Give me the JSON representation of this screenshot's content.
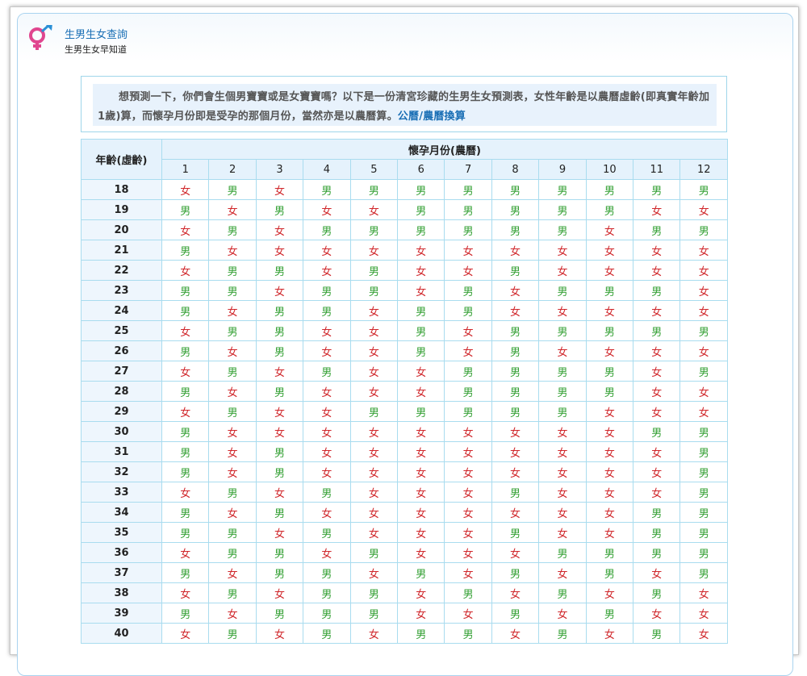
{
  "header": {
    "title": "生男生女查詢",
    "subtitle": "生男生女早知道",
    "logo_icon": "gender-symbol-icon"
  },
  "intro": {
    "text": "想預測一下，你們會生個男寶寶或是女寶寶嗎？以下是一份清宮珍藏的生男生女預測表，女性年齡是以農曆虛齡(即真實年齡加1歲)算，而懷孕月份即是受孕的那個月份，當然亦是以農曆算。",
    "link_label": "公曆/農曆換算"
  },
  "table": {
    "age_header": "年齡(虛齡)",
    "month_header": "懷孕月份(農曆)",
    "months": [
      "1",
      "2",
      "3",
      "4",
      "5",
      "6",
      "7",
      "8",
      "9",
      "10",
      "11",
      "12"
    ],
    "colors": {
      "boy": "#33a033",
      "girl": "#d0272b"
    },
    "rows": [
      {
        "age": "18",
        "cells": [
          "女",
          "男",
          "女",
          "男",
          "男",
          "男",
          "男",
          "男",
          "男",
          "男",
          "男",
          "男"
        ]
      },
      {
        "age": "19",
        "cells": [
          "男",
          "女",
          "男",
          "女",
          "女",
          "男",
          "男",
          "男",
          "男",
          "男",
          "女",
          "女"
        ]
      },
      {
        "age": "20",
        "cells": [
          "女",
          "男",
          "女",
          "男",
          "男",
          "男",
          "男",
          "男",
          "男",
          "女",
          "男",
          "男"
        ]
      },
      {
        "age": "21",
        "cells": [
          "男",
          "女",
          "女",
          "女",
          "女",
          "女",
          "女",
          "女",
          "女",
          "女",
          "女",
          "女"
        ]
      },
      {
        "age": "22",
        "cells": [
          "女",
          "男",
          "男",
          "女",
          "男",
          "女",
          "女",
          "男",
          "女",
          "女",
          "女",
          "女"
        ]
      },
      {
        "age": "23",
        "cells": [
          "男",
          "男",
          "女",
          "男",
          "男",
          "女",
          "男",
          "女",
          "男",
          "男",
          "男",
          "女"
        ]
      },
      {
        "age": "24",
        "cells": [
          "男",
          "女",
          "男",
          "男",
          "女",
          "男",
          "男",
          "女",
          "女",
          "女",
          "女",
          "女"
        ]
      },
      {
        "age": "25",
        "cells": [
          "女",
          "男",
          "男",
          "女",
          "女",
          "男",
          "女",
          "男",
          "男",
          "男",
          "男",
          "男"
        ]
      },
      {
        "age": "26",
        "cells": [
          "男",
          "女",
          "男",
          "女",
          "女",
          "男",
          "女",
          "男",
          "女",
          "女",
          "女",
          "女"
        ]
      },
      {
        "age": "27",
        "cells": [
          "女",
          "男",
          "女",
          "男",
          "女",
          "女",
          "男",
          "男",
          "男",
          "男",
          "女",
          "男"
        ]
      },
      {
        "age": "28",
        "cells": [
          "男",
          "女",
          "男",
          "女",
          "女",
          "女",
          "男",
          "男",
          "男",
          "男",
          "女",
          "女"
        ]
      },
      {
        "age": "29",
        "cells": [
          "女",
          "男",
          "女",
          "女",
          "男",
          "男",
          "男",
          "男",
          "男",
          "女",
          "女",
          "女"
        ]
      },
      {
        "age": "30",
        "cells": [
          "男",
          "女",
          "女",
          "女",
          "女",
          "女",
          "女",
          "女",
          "女",
          "女",
          "男",
          "男"
        ]
      },
      {
        "age": "31",
        "cells": [
          "男",
          "女",
          "男",
          "女",
          "女",
          "女",
          "女",
          "女",
          "女",
          "女",
          "女",
          "男"
        ]
      },
      {
        "age": "32",
        "cells": [
          "男",
          "女",
          "男",
          "女",
          "女",
          "女",
          "女",
          "女",
          "女",
          "女",
          "女",
          "男"
        ]
      },
      {
        "age": "33",
        "cells": [
          "女",
          "男",
          "女",
          "男",
          "女",
          "女",
          "女",
          "男",
          "女",
          "女",
          "女",
          "男"
        ]
      },
      {
        "age": "34",
        "cells": [
          "男",
          "女",
          "男",
          "女",
          "女",
          "女",
          "女",
          "女",
          "女",
          "女",
          "男",
          "男"
        ]
      },
      {
        "age": "35",
        "cells": [
          "男",
          "男",
          "女",
          "男",
          "女",
          "女",
          "女",
          "男",
          "女",
          "女",
          "男",
          "男"
        ]
      },
      {
        "age": "36",
        "cells": [
          "女",
          "男",
          "男",
          "女",
          "男",
          "女",
          "女",
          "女",
          "男",
          "男",
          "男",
          "男"
        ]
      },
      {
        "age": "37",
        "cells": [
          "男",
          "女",
          "男",
          "男",
          "女",
          "男",
          "女",
          "男",
          "女",
          "男",
          "女",
          "男"
        ]
      },
      {
        "age": "38",
        "cells": [
          "女",
          "男",
          "女",
          "男",
          "男",
          "女",
          "男",
          "女",
          "男",
          "女",
          "男",
          "女"
        ]
      },
      {
        "age": "39",
        "cells": [
          "男",
          "女",
          "男",
          "男",
          "男",
          "女",
          "女",
          "男",
          "女",
          "男",
          "女",
          "女"
        ]
      },
      {
        "age": "40",
        "cells": [
          "女",
          "男",
          "女",
          "男",
          "女",
          "男",
          "男",
          "女",
          "男",
          "女",
          "男",
          "女"
        ]
      }
    ]
  }
}
